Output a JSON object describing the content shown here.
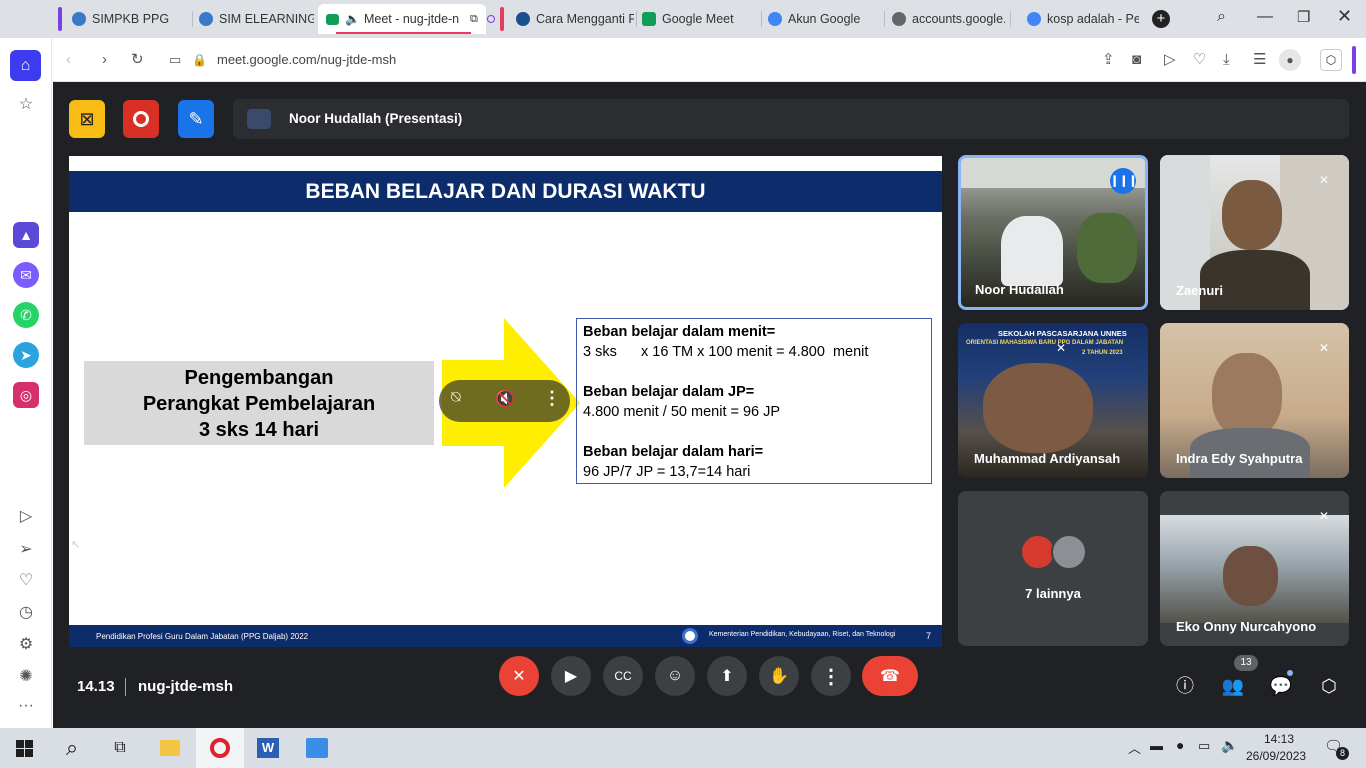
{
  "browser": {
    "tabs": [
      {
        "label": "SIMPKB PPG",
        "active": false
      },
      {
        "label": "SIM ELEARNING",
        "active": false
      },
      {
        "label": "Meet - nug-jtde-n",
        "active": true
      },
      {
        "label": "Cara Mengganti F",
        "active": false
      },
      {
        "label": "Google Meet",
        "active": false
      },
      {
        "label": "Akun Google",
        "active": false
      },
      {
        "label": "accounts.google.c",
        "active": false
      },
      {
        "label": "kosp adalah - Pen",
        "active": false
      }
    ],
    "url": "meet.google.com/nug-jtde-msh",
    "new_tab": "+"
  },
  "meet": {
    "presenter_label": "Noor Hudallah (Presentasi)",
    "slide": {
      "title": "BEBAN BELAJAR DAN DURASI WAKTU",
      "left_box": [
        "Pengembangan",
        "Perangkat  Pembelajaran",
        "3 sks 14 hari"
      ],
      "info": [
        {
          "heading": "Beban belajar dalam menit=",
          "value": "3 sks      x 16 TM x 100 menit = 4.800  menit"
        },
        {
          "heading": "Beban belajar dalam JP=",
          "value": "4.800 menit / 50 menit = 96 JP"
        },
        {
          "heading": "Beban belajar dalam hari=",
          "value": "96 JP/7 JP = 13,7=14 hari"
        }
      ],
      "footer_left": "Pendidikan Profesi Guru Dalam Jabatan (PPG Daljab) 2022",
      "footer_right": "Kementerian Pendidikan, Kebudayaan, Riset, dan Teknologi",
      "page_number": "7"
    },
    "participants": [
      {
        "name": "Noor Hudallah"
      },
      {
        "name": "Zaenuri"
      },
      {
        "name": "Muhammad Ardiyansah",
        "banner_line1": "SEKOLAH PASCASARJANA UNNES",
        "banner_line2": "ORIENTASI MAHASISWA BARU PPG DALAM JABATAN",
        "banner_line3": "2 TAHUN 2023"
      },
      {
        "name": "Indra Edy Syahputra"
      },
      {
        "name": "7 lainnya"
      },
      {
        "name": "Eko Onny Nurcahyono"
      }
    ],
    "time": "14.13",
    "meeting_code": "nug-jtde-msh",
    "people_count": "13"
  },
  "taskbar": {
    "time": "14:13",
    "date": "26/09/2023",
    "notifications": "8"
  },
  "colors": {
    "meet_bg": "#202124",
    "slide_navy": "#0d2c6b",
    "arrow_yellow": "#ffee00",
    "end_call_red": "#ea4335"
  }
}
